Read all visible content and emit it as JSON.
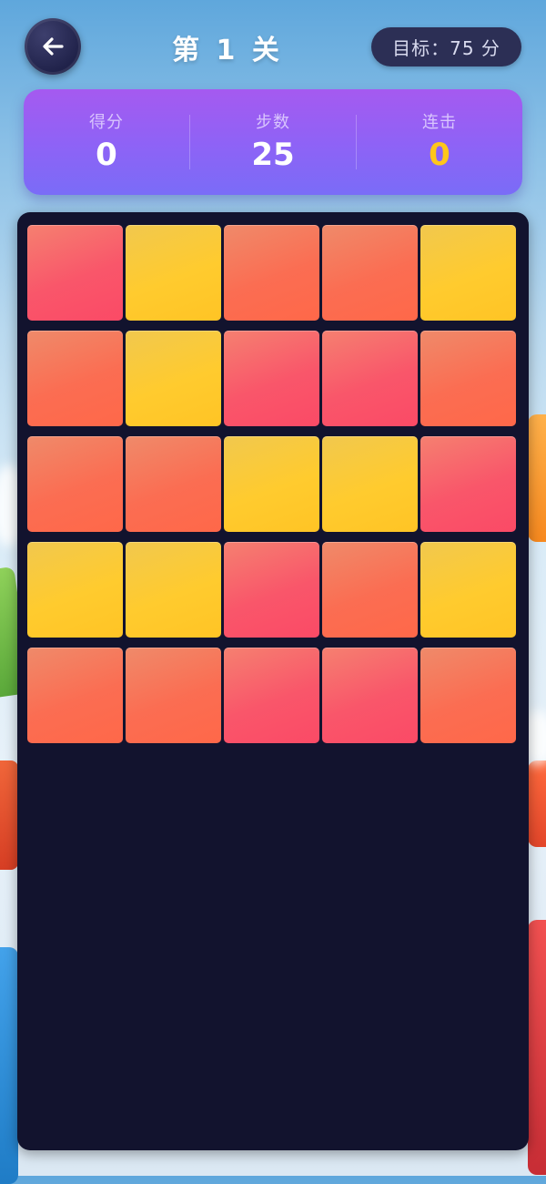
{
  "header": {
    "back_icon": "arrow-left-icon",
    "level_title": "第 1 关",
    "target_text": "目标：75 分"
  },
  "stats": {
    "score_label": "得分",
    "score_value": "0",
    "moves_label": "步数",
    "moves_value": "25",
    "combo_label": "连击",
    "combo_value": "0"
  },
  "colors": {
    "red": "#fb4a66",
    "orange": "#ff6849",
    "yellow": "#ffc425",
    "panel_purple": "#8d63f6",
    "combo_yellow": "#ffc61a",
    "board_bg": "#12132e"
  },
  "board": {
    "rows": 5,
    "cols": 5,
    "tiles": [
      [
        "red",
        "yellow",
        "orange",
        "orange",
        "yellow"
      ],
      [
        "orange",
        "yellow",
        "red",
        "red",
        "orange"
      ],
      [
        "orange",
        "orange",
        "yellow",
        "yellow",
        "red"
      ],
      [
        "yellow",
        "yellow",
        "red",
        "orange",
        "yellow"
      ],
      [
        "orange",
        "orange",
        "red",
        "red",
        "orange"
      ]
    ]
  }
}
